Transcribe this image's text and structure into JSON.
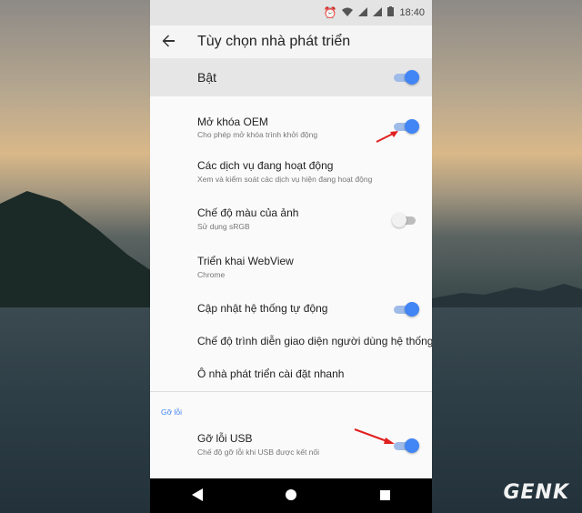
{
  "status_bar": {
    "time": "18:40",
    "icons": [
      "alarm-icon",
      "wifi-icon",
      "signal-icon",
      "signal-icon",
      "battery-icon"
    ]
  },
  "app_bar": {
    "title": "Tùy chọn nhà phát triển",
    "back_icon": "arrow-left-icon"
  },
  "master": {
    "label": "Bật",
    "state": "on"
  },
  "items": [
    {
      "title": "Mở khóa OEM",
      "subtitle": "Cho phép mở khóa trình khởi động",
      "toggle": "on"
    },
    {
      "title": "Các dịch vụ đang hoạt động",
      "subtitle": "Xem và kiểm soát các dịch vụ hiện đang hoạt động",
      "toggle": null
    },
    {
      "title": "Chế độ màu của ảnh",
      "subtitle": "Sử dụng sRGB",
      "toggle": "off"
    },
    {
      "title": "Triển khai WebView",
      "subtitle": "Chrome",
      "toggle": null
    },
    {
      "title": "Cập nhật hệ thống tự động",
      "subtitle": "",
      "toggle": "on"
    },
    {
      "title": "Chế độ trình diễn giao diện người dùng hệ thống",
      "subtitle": "",
      "toggle": null
    },
    {
      "title": "Ô nhà phát triển cài đặt nhanh",
      "subtitle": "",
      "toggle": null
    }
  ],
  "debug_section": {
    "label": "Gỡ lỗi",
    "items": [
      {
        "title": "Gỡ lỗi USB",
        "subtitle": "Chế độ gỡ lỗi khi USB được kết nối",
        "toggle": "on"
      }
    ]
  },
  "nav_bar": {
    "back": "◀",
    "home": "●",
    "recents": "■"
  },
  "watermark": "GENK",
  "colors": {
    "accent": "#4285f4",
    "arrow": "#e02020"
  }
}
